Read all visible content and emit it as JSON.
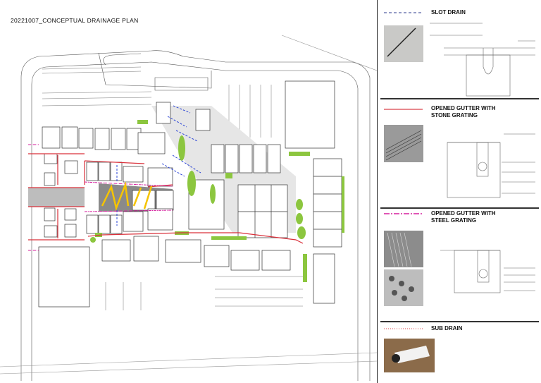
{
  "title": "20221007_CONCEPTUAL DRAINAGE PLAN",
  "legend": [
    {
      "label_lines": [
        "SLOT DRAIN"
      ],
      "line_style": "dashed",
      "color": "#2b3a8c"
    },
    {
      "label_lines": [
        "OPENED GUTTER WITH",
        "STONE GRATING"
      ],
      "line_style": "solid",
      "color": "#d9404a"
    },
    {
      "label_lines": [
        "OPENED GUTTER WITH",
        "STEEL GRATING"
      ],
      "line_style": "dash-dot",
      "color": "#d61f9e"
    },
    {
      "label_lines": [
        "SUB DRAIN"
      ],
      "line_style": "dotted",
      "color": "#d9404a"
    }
  ],
  "colors": {
    "green": "#8cc63f",
    "yellow": "#f5c400",
    "blue": "#2b44d6",
    "red": "#d9303a",
    "magenta": "#d61f9e"
  }
}
